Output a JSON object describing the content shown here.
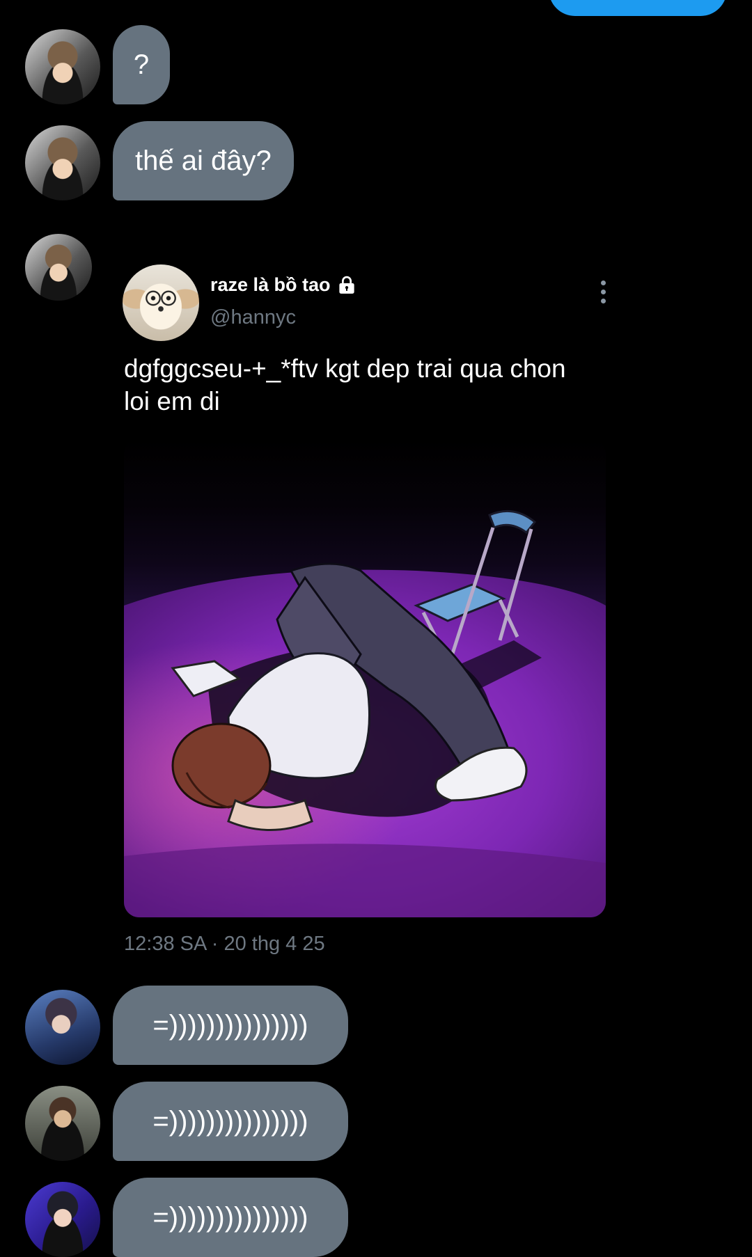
{
  "messages": [
    {
      "text": "?"
    },
    {
      "text": "thế ai đây?"
    }
  ],
  "shared_tweet": {
    "display_name": "raze là bồ tao",
    "protected_icon": "lock-icon",
    "handle": "@hannyc",
    "text_line1": "dgfggcseu-+_*ftv kgt dep trai qua chon",
    "text_line2": "loi em di",
    "timestamp": "12:38 SA · 20 thg 4 25",
    "more_icon": "more-vertical-icon"
  },
  "replies": [
    {
      "text": "=)))))))))))))))"
    },
    {
      "text": "=)))))))))))))))"
    },
    {
      "text": "=)))))))))))))))"
    }
  ],
  "colors": {
    "background": "#000000",
    "incoming_bubble": "#66737f",
    "outgoing_bubble": "#1d9bf0",
    "secondary_text": "#6e7882"
  }
}
